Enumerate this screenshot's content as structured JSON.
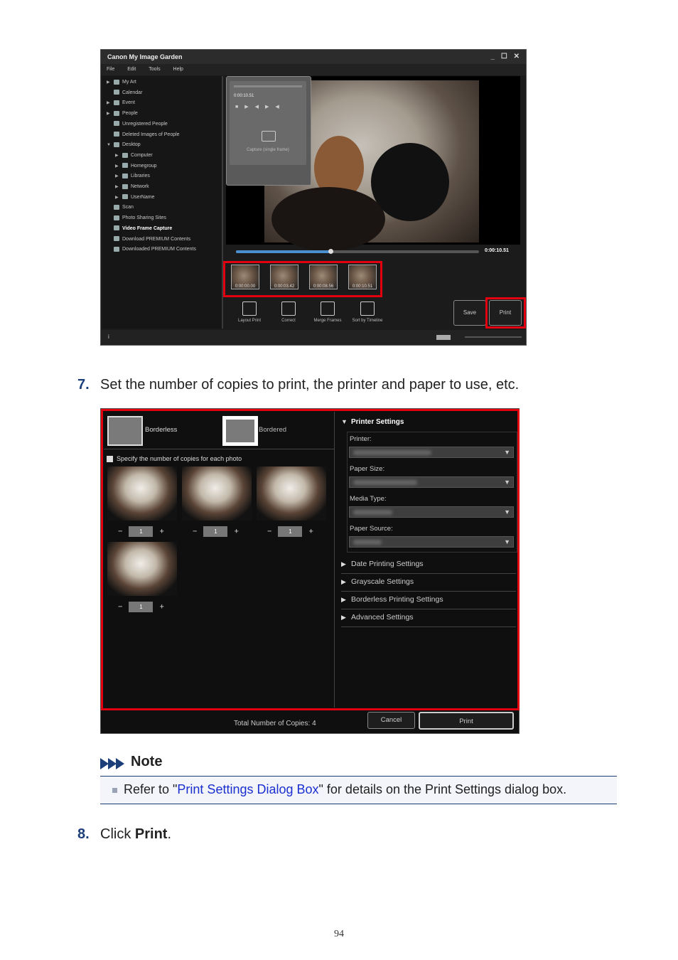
{
  "screenshot1": {
    "title": "Canon My Image Garden",
    "window_buttons": "_ ☐ ✕",
    "menu": [
      "File",
      "Edit",
      "Tools",
      "Help"
    ],
    "tree": [
      {
        "label": "My Art",
        "expand": "▶",
        "indent": 0
      },
      {
        "label": "Calendar",
        "expand": "",
        "indent": 0
      },
      {
        "label": "Event",
        "expand": "▶",
        "indent": 0
      },
      {
        "label": "People",
        "expand": "▶",
        "indent": 0
      },
      {
        "label": "Unregistered People",
        "expand": "",
        "indent": 0
      },
      {
        "label": "Deleted Images of People",
        "expand": "",
        "indent": 0
      },
      {
        "label": "Desktop",
        "expand": "▼",
        "indent": 0
      },
      {
        "label": "Computer",
        "expand": "▶",
        "indent": 1
      },
      {
        "label": "Homegroup",
        "expand": "▶",
        "indent": 1
      },
      {
        "label": "Libraries",
        "expand": "▶",
        "indent": 1
      },
      {
        "label": "Network",
        "expand": "▶",
        "indent": 1
      },
      {
        "label": "UserName",
        "expand": "▶",
        "indent": 1
      },
      {
        "label": "Scan",
        "expand": "",
        "indent": 0
      },
      {
        "label": "Photo Sharing Sites",
        "expand": "",
        "indent": 0
      },
      {
        "label": "Video Frame Capture",
        "expand": "",
        "indent": 0,
        "selected": true
      },
      {
        "label": "Download PREMIUM Contents",
        "expand": "",
        "indent": 0
      },
      {
        "label": "Downloaded PREMIUM Contents",
        "expand": "",
        "indent": 0
      }
    ],
    "panel_time": "0:00:10.51",
    "capture_label": "Capture (single frame)",
    "seek_progress": 0.39,
    "seek_time": "0:00:10.51",
    "thumbs": [
      "0:00:00.00",
      "0:00:03.42",
      "0:00:08.56",
      "0:00:10.51"
    ],
    "tools": [
      "Layout Print",
      "Correct",
      "Merge Frames",
      "Sort by Timeline"
    ],
    "save_label": "Save",
    "print_label": "Print",
    "highlight_color": "#e00010"
  },
  "step7": {
    "num": "7.",
    "text": "Set the number of copies to print, the printer and paper to use, etc."
  },
  "screenshot2": {
    "borderless": "Borderless",
    "bordered": "Bordered",
    "specify_label": "Specify the number of copies for each photo",
    "copies": [
      "1",
      "1",
      "1",
      "1"
    ],
    "minus": "−",
    "plus": "+",
    "printer_settings": "Printer Settings",
    "fields": [
      "Printer:",
      "Paper Size:",
      "Media Type:",
      "Paper Source:"
    ],
    "sections": [
      "Date Printing Settings",
      "Grayscale Settings",
      "Borderless Printing Settings",
      "Advanced Settings"
    ],
    "total_label": "Total Number of Copies:",
    "total_value": "4",
    "cancel_label": "Cancel",
    "print_label": "Print"
  },
  "note": {
    "title": "Note",
    "prefix": "Refer to \"",
    "link": "Print Settings Dialog Box",
    "suffix": "\" for details on the Print Settings dialog box."
  },
  "step8": {
    "num": "8.",
    "text_prefix": "Click ",
    "text_bold": "Print",
    "text_suffix": "."
  },
  "page_number": "94"
}
